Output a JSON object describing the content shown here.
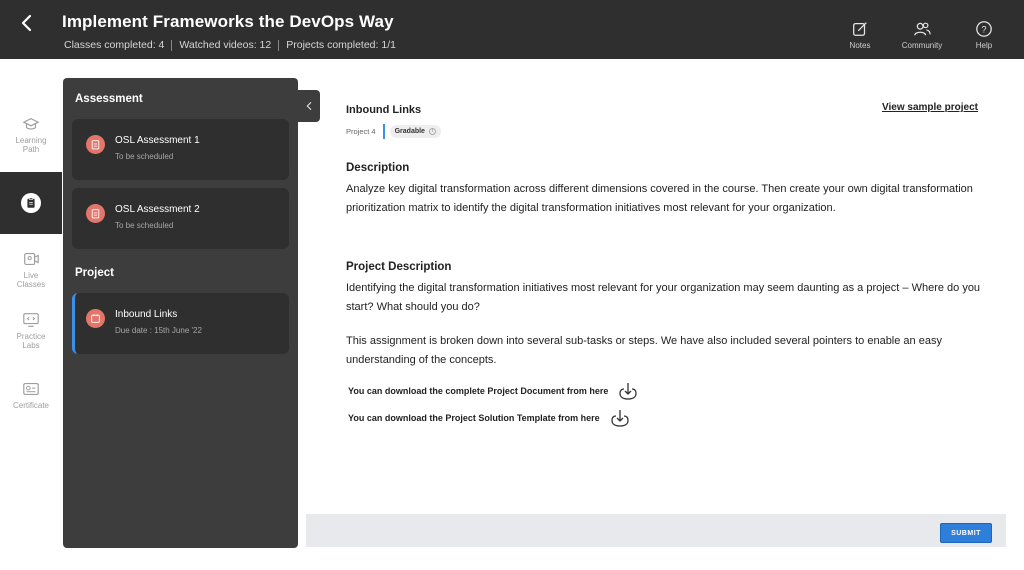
{
  "header": {
    "title": "Implement Frameworks the DevOps Way",
    "stats": [
      "Classes completed: 4",
      "Watched videos: 12",
      "Projects completed: 1/1"
    ],
    "actions": [
      {
        "label": "Notes",
        "icon": "notes-icon"
      },
      {
        "label": "Community",
        "icon": "community-icon"
      },
      {
        "label": "Help",
        "icon": "help-icon"
      }
    ]
  },
  "rail": {
    "items": [
      {
        "label_line1": "Learning",
        "label_line2": "Path",
        "icon": "learning-path-icon"
      },
      {
        "label_line1": "",
        "label_line2": "",
        "icon": "assignment-icon",
        "active": true
      },
      {
        "label_line1": "Live",
        "label_line2": "Classes",
        "icon": "live-classes-icon"
      },
      {
        "label_line1": "Practice",
        "label_line2": "Labs",
        "icon": "practice-labs-icon"
      },
      {
        "label_line1": "Certificate",
        "label_line2": "",
        "icon": "certificate-icon"
      }
    ]
  },
  "panel": {
    "assessment_heading": "Assessment",
    "assessments": [
      {
        "title": "OSL Assessment 1",
        "subtitle": "To be scheduled"
      },
      {
        "title": "OSL Assessment 2",
        "subtitle": "To be scheduled"
      }
    ],
    "project_heading": "Project",
    "projects": [
      {
        "title": "Inbound Links",
        "subtitle": "Due date : 15th June '22",
        "active": true
      }
    ]
  },
  "main": {
    "project_title": "Inbound Links",
    "view_sample_label": "View sample project",
    "project_number": "Project 4",
    "badge": "Gradable",
    "description_heading": "Description",
    "description_text": "Analyze key digital transformation across different dimensions covered in the course. Then create your own digital transformation prioritization matrix to identify the digital transformation initiatives most relevant for your organization.",
    "project_description_heading": "Project Description",
    "project_description_p1": "Identifying the digital transformation initiatives most relevant for your organization may seem daunting as a project – Where do you start? What should you do?",
    "project_description_p2": "This assignment is broken down into several sub-tasks or steps. We have also included several pointers to enable an easy understanding of the concepts.",
    "download_document_label": "You can download the complete Project Document from here",
    "download_template_label": "You can download the Project Solution Template from here"
  },
  "footer": {
    "submit_label": "SUBMIT"
  },
  "colors": {
    "header_bg": "#2f2f2f",
    "panel_bg": "#3d3d3d",
    "card_bg": "#2f2f2f",
    "accent_blue": "#3b8fe6",
    "icon_coral": "#e3766b",
    "submit_blue": "#2e7fd9"
  }
}
